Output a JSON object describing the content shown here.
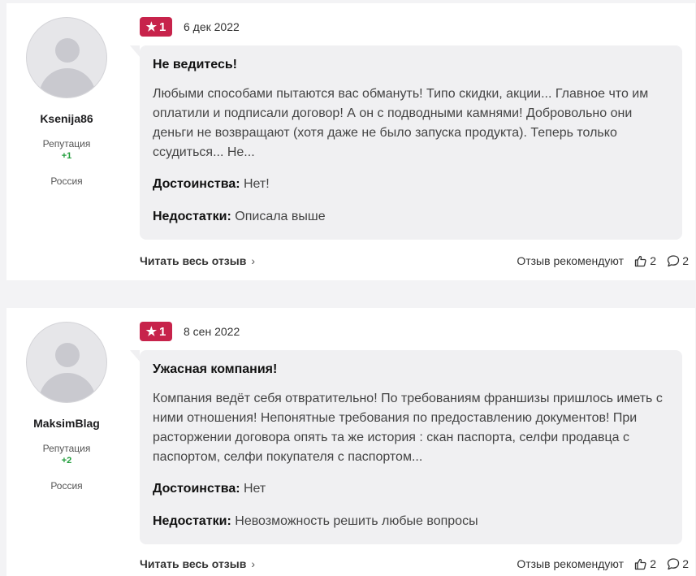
{
  "reviews": [
    {
      "user": {
        "name": "Ksenija86",
        "reputation_label": "Репутация",
        "reputation_value": "+1",
        "country": "Россия"
      },
      "rating": "1",
      "date": "6 дек 2022",
      "title": "Не ведитесь!",
      "text": "Любыми способами пытаются вас обмануть! Типо скидки, акции... Главное что им оплатили и подписали договор! А он с подводными камнями! Добровольно они деньги не возвращают (хотя даже не было запуска продукта). Теперь только ссудиться... Не...",
      "pros_label": "Достоинства:",
      "pros": "Нет!",
      "cons_label": "Недостатки:",
      "cons": "Описала выше",
      "read_more": "Читать весь отзыв",
      "recommend": "Отзыв рекомендуют",
      "likes": "2",
      "comments": "2"
    },
    {
      "user": {
        "name": "MaksimBlag",
        "reputation_label": "Репутация",
        "reputation_value": "+2",
        "country": "Россия"
      },
      "rating": "1",
      "date": "8 сен 2022",
      "title": "Ужасная компания!",
      "text": "Компания ведёт себя отвратительно! По требованиям франшизы пришлось иметь с ними отношения! Непонятные требования по предоставлению документов! При расторжении договора опять та же история : скан паспорта, селфи продавца с паспортом, селфи покупателя с паспортом...",
      "pros_label": "Достоинства:",
      "pros": "Нет",
      "cons_label": "Недостатки:",
      "cons": "Невозможность решить любые вопросы",
      "read_more": "Читать весь отзыв",
      "recommend": "Отзыв рекомендуют",
      "likes": "2",
      "comments": "2"
    }
  ],
  "icons": {
    "star": "star-icon",
    "chevron": "chevron-right-icon",
    "like": "thumbs-up-icon",
    "comment": "comment-icon"
  },
  "colors": {
    "badge": "#c7234b",
    "reputation": "#1f9d3a",
    "bubble": "#f0f0f2"
  }
}
